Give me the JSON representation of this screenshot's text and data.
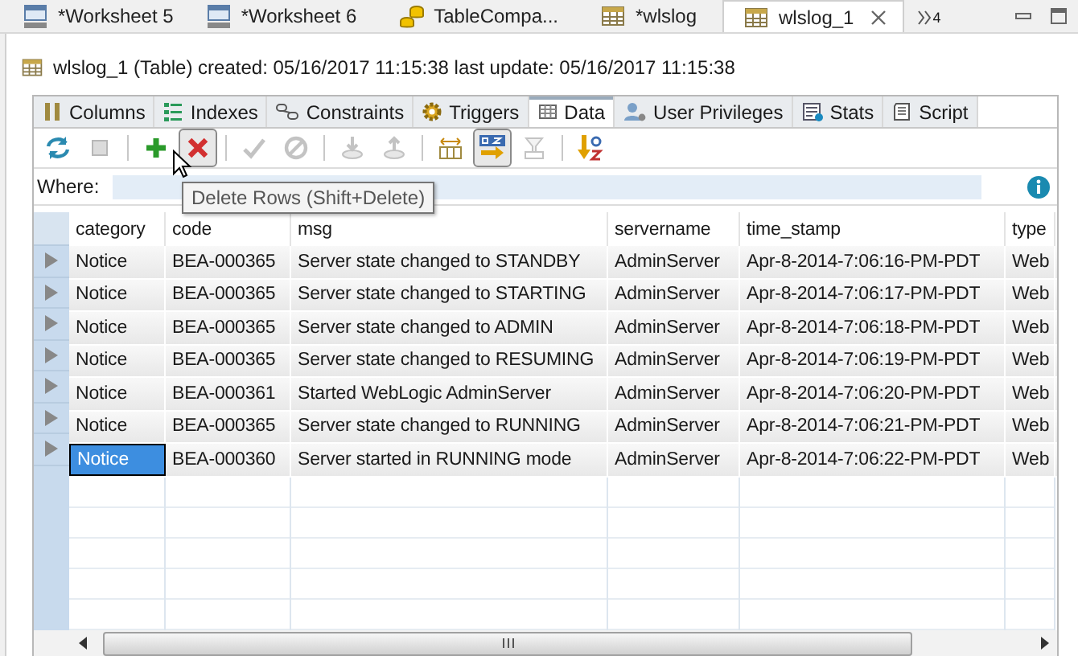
{
  "editor_tabs": [
    {
      "label": "*Worksheet 5",
      "kind": "sql",
      "selected": false
    },
    {
      "label": "*Worksheet 6",
      "kind": "sql",
      "selected": false
    },
    {
      "label": "TableCompa...",
      "kind": "compare",
      "selected": false
    },
    {
      "label": "*wlslog",
      "kind": "table",
      "selected": false
    },
    {
      "label": "wlslog_1",
      "kind": "table",
      "selected": true
    }
  ],
  "overflow_count": "4",
  "info_line": "wlslog_1 (Table) created: 05/16/2017 11:15:38 last update: 05/16/2017 11:15:38",
  "sub_tabs": [
    {
      "label": "Columns",
      "kind": "columns",
      "selected": false
    },
    {
      "label": "Indexes",
      "kind": "indexes",
      "selected": false
    },
    {
      "label": "Constraints",
      "kind": "constraints",
      "selected": false
    },
    {
      "label": "Triggers",
      "kind": "triggers",
      "selected": false
    },
    {
      "label": "Data",
      "kind": "data",
      "selected": true
    },
    {
      "label": "User Privileges",
      "kind": "privileges",
      "selected": false
    },
    {
      "label": "Stats",
      "kind": "stats",
      "selected": false
    },
    {
      "label": "Script",
      "kind": "script",
      "selected": false
    }
  ],
  "toolbar": [
    {
      "kind": "refresh",
      "disabled": false,
      "pressed": false
    },
    {
      "kind": "stop",
      "disabled": true,
      "pressed": false
    },
    {
      "kind": "sep"
    },
    {
      "kind": "add",
      "disabled": false,
      "pressed": false
    },
    {
      "kind": "delete",
      "disabled": false,
      "pressed": true
    },
    {
      "kind": "sep"
    },
    {
      "kind": "commit",
      "disabled": true,
      "pressed": false
    },
    {
      "kind": "cancel",
      "disabled": true,
      "pressed": false
    },
    {
      "kind": "sep"
    },
    {
      "kind": "import",
      "disabled": true,
      "pressed": false
    },
    {
      "kind": "export",
      "disabled": true,
      "pressed": false
    },
    {
      "kind": "sep"
    },
    {
      "kind": "columns",
      "disabled": false,
      "pressed": false
    },
    {
      "kind": "sort-toggle",
      "disabled": false,
      "pressed": true
    },
    {
      "kind": "filter",
      "disabled": true,
      "pressed": false
    },
    {
      "kind": "sep"
    },
    {
      "kind": "sort",
      "disabled": false,
      "pressed": false
    }
  ],
  "where": {
    "label": "Where:"
  },
  "tooltip": "Delete Rows (Shift+Delete)",
  "table": {
    "columns": [
      "category",
      "code",
      "msg",
      "servername",
      "time_stamp",
      "type"
    ],
    "rows": [
      {
        "cells": [
          "Notice",
          "BEA-000365",
          "Server state changed to STANDBY",
          "AdminServer",
          "Apr-8-2014-7:06:16-PM-PDT",
          "Web"
        ],
        "selected": false
      },
      {
        "cells": [
          "Notice",
          "BEA-000365",
          "Server state changed to STARTING",
          "AdminServer",
          "Apr-8-2014-7:06:17-PM-PDT",
          "Web"
        ],
        "selected": false
      },
      {
        "cells": [
          "Notice",
          "BEA-000365",
          "Server state changed to ADMIN",
          "AdminServer",
          "Apr-8-2014-7:06:18-PM-PDT",
          "Web"
        ],
        "selected": false
      },
      {
        "cells": [
          "Notice",
          "BEA-000365",
          "Server state changed to RESUMING",
          "AdminServer",
          "Apr-8-2014-7:06:19-PM-PDT",
          "Web"
        ],
        "selected": false
      },
      {
        "cells": [
          "Notice",
          "BEA-000361",
          "Started WebLogic AdminServer",
          "AdminServer",
          "Apr-8-2014-7:06:20-PM-PDT",
          "Web"
        ],
        "selected": false
      },
      {
        "cells": [
          "Notice",
          "BEA-000365",
          "Server state changed to RUNNING",
          "AdminServer",
          "Apr-8-2014-7:06:21-PM-PDT",
          "Web"
        ],
        "selected": false
      },
      {
        "cells": [
          "Notice",
          "BEA-000360",
          "Server started in RUNNING mode",
          "AdminServer",
          "Apr-8-2014-7:06:22-PM-PDT",
          "Web"
        ],
        "selected": true
      }
    ]
  }
}
